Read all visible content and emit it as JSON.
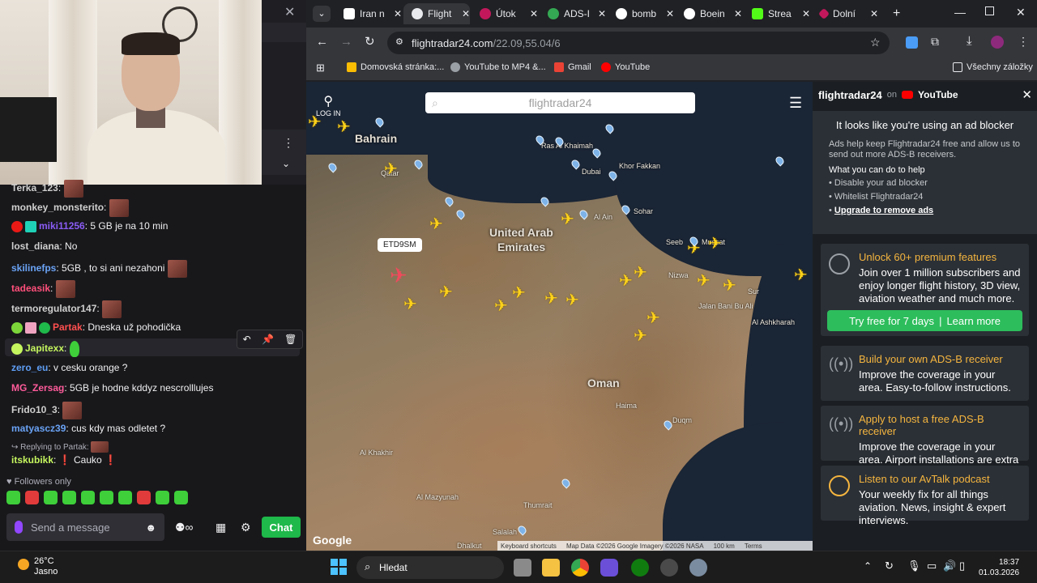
{
  "chat": {
    "messages": [
      {
        "user": "Terka_123",
        "text": "",
        "color": "#cfcfcf"
      },
      {
        "user": "monkey_monsterito",
        "text": "",
        "color": "#cfcfcf"
      },
      {
        "user": "miki11256",
        "text": "5 GB je na 10 min",
        "color": "#8a5cf5"
      },
      {
        "user": "lost_diana",
        "text": "No",
        "color": "#cfcfcf"
      },
      {
        "user": "skilinefps",
        "text": "5GB , to si ani nezahoni",
        "color": "#6aa3f5"
      },
      {
        "user": "tadeasik",
        "text": "",
        "color": "#ff4f7a"
      },
      {
        "user": "termoregulator147",
        "text": "",
        "color": "#cfcfcf"
      },
      {
        "user": "Partak",
        "text": "Dneska už pohodička",
        "color": "#ff4f4f"
      },
      {
        "user": "Japitexx",
        "text": "",
        "color": "#c5f55e"
      },
      {
        "user": "zero_eu",
        "text": "v cesku orange ?",
        "color": "#5f9ff5"
      },
      {
        "user": "MG_Zersag",
        "text": "5GB je hodne kddyz nescrolllujes",
        "color": "#ff5b9a"
      },
      {
        "user": "Frido10_3",
        "text": "",
        "color": "#cfcfcf"
      },
      {
        "user": "matyascz39",
        "text": "cus kdy mas odletet ?",
        "color": "#6aa3f5"
      },
      {
        "user": "itskubikk",
        "text": "Cauko",
        "color": "#c5f55e"
      }
    ],
    "reply_to": "Replying to Partak:",
    "followers_only": "Followers only",
    "input_placeholder": "Send a message",
    "chat_button": "Chat"
  },
  "browser": {
    "tabs": [
      "Iran n",
      "Flight",
      "Útok",
      "ADS-I",
      "bomb",
      "Boein",
      "Strea",
      "Dolní"
    ],
    "url_host": "flightradar24.com",
    "url_path": "/22.09,55.04/6",
    "bookmarks": [
      "Domovská stránka:...",
      "YouTube to MP4 &...",
      "Gmail",
      "YouTube"
    ],
    "all_bookmarks": "Všechny záložky"
  },
  "map": {
    "search_placeholder": "flightradar24",
    "login": "LOG IN",
    "callsign": "ETD9SM",
    "countries": [
      "Bahrain",
      "United Arab",
      "Emirates",
      "Oman"
    ],
    "cities": [
      "Qatar",
      "Ras Al Khaimah",
      "Dubai",
      "Khor Fakkan",
      "Al Ain",
      "Sohar",
      "Seeb",
      "Muscat",
      "Nizwa",
      "Sur",
      "Jalan Bani Bu Ali",
      "Al Ashkharah",
      "Haima",
      "Duqm",
      "Al Khakhir",
      "Al Mazyunah",
      "Thumrait",
      "Salalah",
      "Dhalkut"
    ],
    "google": "Google",
    "footer": [
      "Keyboard shortcuts",
      "Map Data ©2026 Google Imagery ©2026 NASA",
      "100 km",
      "Terms"
    ]
  },
  "panel": {
    "brand": "flightradar24",
    "on": "on",
    "youtube": "YouTube",
    "ad_title": "It looks like you're using an ad blocker",
    "ad_text": "Ads help keep Flightradar24 free and allow us to send out more ADS-B receivers.",
    "what_you_can": "What you can do to help",
    "options": [
      "Disable your ad blocker",
      "Whitelist Flightradar24",
      "Upgrade to remove ads"
    ],
    "cards": [
      {
        "title": "Unlock 60+ premium features",
        "text": "Join over 1 million subscribers and enjoy longer flight history, 3D view, aviation weather and much more."
      },
      {
        "title": "Build your own ADS-B receiver",
        "text": "Improve the coverage in your area. Easy-to-follow instructions."
      },
      {
        "title": "Apply to host a free ADS-B receiver",
        "text": "Improve the coverage in your area. Airport installations are extra helpful."
      },
      {
        "title": "Listen to our AvTalk podcast",
        "text": "Your weekly fix for all things aviation. News, insight & expert interviews."
      }
    ],
    "cta_try": "Try free for 7 days",
    "cta_sep": "|",
    "cta_learn": "Learn more"
  },
  "taskbar": {
    "temp": "26°C",
    "weather": "Jasno",
    "search": "Hledat",
    "time": "18:37",
    "date": "01.03.2026"
  }
}
